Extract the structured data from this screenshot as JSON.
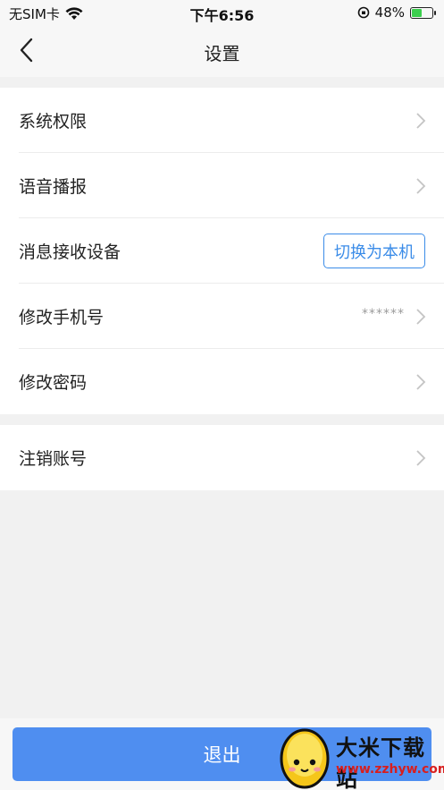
{
  "status_bar": {
    "carrier": "无SIM卡",
    "time": "下午6:56",
    "battery": "48%",
    "battery_level": 0.48
  },
  "nav": {
    "title": "设置"
  },
  "settings": {
    "group1": [
      {
        "label": "系统权限"
      },
      {
        "label": "语音播报"
      },
      {
        "label": "消息接收设备",
        "action": "切换为本机"
      },
      {
        "label": "修改手机号",
        "value": "******"
      },
      {
        "label": "修改密码"
      }
    ],
    "group2": [
      {
        "label": "注销账号"
      }
    ]
  },
  "logout": {
    "label": "退出"
  },
  "watermark": {
    "title": "大米下载站",
    "url": "www.zzhyw.com"
  },
  "colors": {
    "accent": "#4f8ef0",
    "link": "#3b8ce8"
  }
}
